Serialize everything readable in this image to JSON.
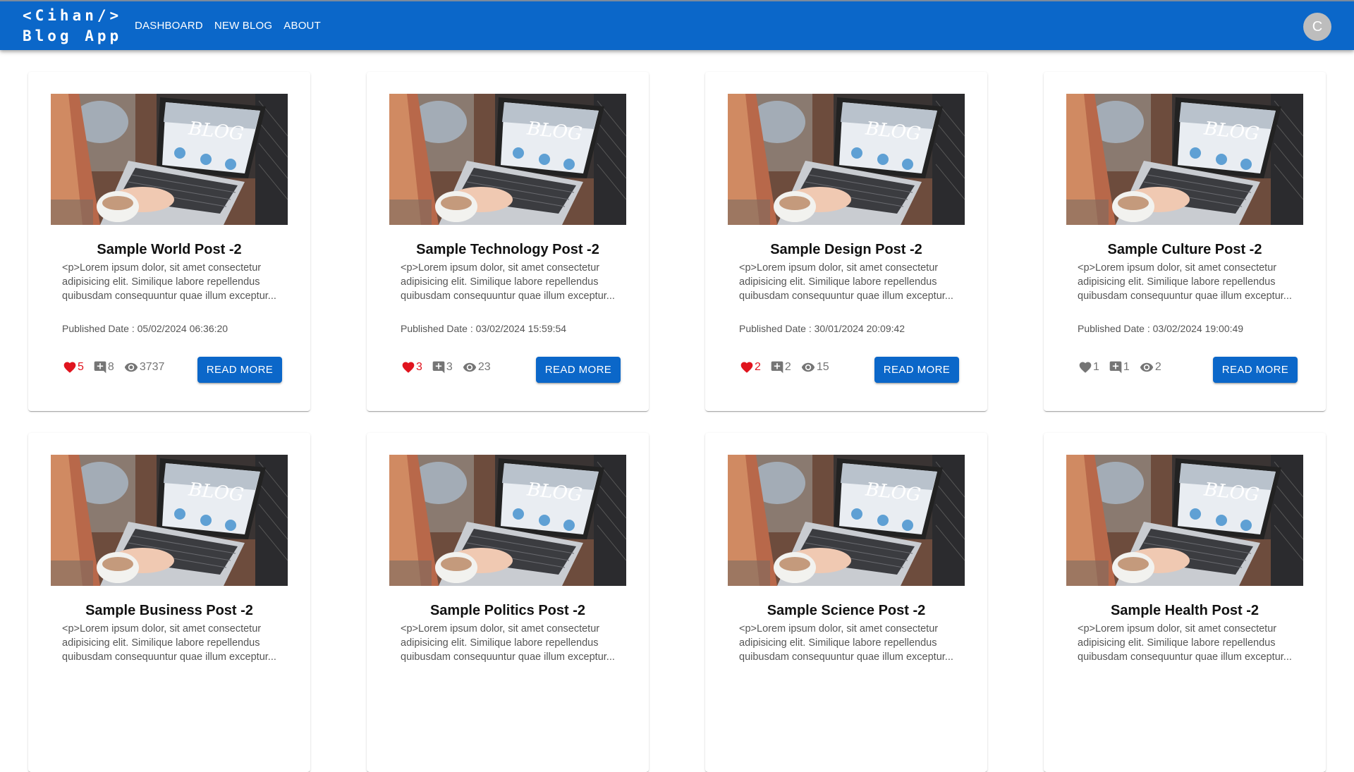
{
  "app": {
    "logo_line1": "<Cihan/>",
    "logo_line2": "Blog App",
    "nav": [
      "DASHBOARD",
      "NEW BLOG",
      "ABOUT"
    ],
    "avatar_initial": "C"
  },
  "colors": {
    "primary": "#0b67c9",
    "like_active": "#e0141e",
    "icon_gray": "#757575"
  },
  "icons": {
    "like": "heart-icon",
    "comments": "add-comment-icon",
    "views": "eye-icon"
  },
  "read_more_label": "READ MORE",
  "published_prefix": "Published Date : ",
  "posts": [
    {
      "title": "Sample World Post -2",
      "excerpt": "<p>Lorem ipsum dolor, sit amet consectetur adipisicing elit. Similique labore repellendus quibusdam consequuntur quae illum exceptur...",
      "date": "05/02/2024 06:36:20",
      "likes": "5",
      "comments": "8",
      "views": "3737",
      "liked": true
    },
    {
      "title": "Sample Technology Post -2",
      "excerpt": "<p>Lorem ipsum dolor, sit amet consectetur adipisicing elit. Similique labore repellendus quibusdam consequuntur quae illum exceptur...",
      "date": "03/02/2024 15:59:54",
      "likes": "3",
      "comments": "3",
      "views": "23",
      "liked": true
    },
    {
      "title": "Sample Design Post -2",
      "excerpt": "<p>Lorem ipsum dolor, sit amet consectetur adipisicing elit. Similique labore repellendus quibusdam consequuntur quae illum exceptur...",
      "date": "30/01/2024 20:09:42",
      "likes": "2",
      "comments": "2",
      "views": "15",
      "liked": true
    },
    {
      "title": "Sample Culture Post -2",
      "excerpt": "<p>Lorem ipsum dolor, sit amet consectetur adipisicing elit. Similique labore repellendus quibusdam consequuntur quae illum exceptur...",
      "date": "03/02/2024 19:00:49",
      "likes": "1",
      "comments": "1",
      "views": "2",
      "liked": false
    },
    {
      "title": "Sample Business Post -2",
      "excerpt": "<p>Lorem ipsum dolor, sit amet consectetur adipisicing elit. Similique labore repellendus quibusdam consequuntur quae illum exceptur...",
      "date": "",
      "likes": "",
      "comments": "",
      "views": "",
      "liked": false
    },
    {
      "title": "Sample Politics Post -2",
      "excerpt": "<p>Lorem ipsum dolor, sit amet consectetur adipisicing elit. Similique labore repellendus quibusdam consequuntur quae illum exceptur...",
      "date": "",
      "likes": "",
      "comments": "",
      "views": "",
      "liked": false
    },
    {
      "title": "Sample Science Post -2",
      "excerpt": "<p>Lorem ipsum dolor, sit amet consectetur adipisicing elit. Similique labore repellendus quibusdam consequuntur quae illum exceptur...",
      "date": "",
      "likes": "",
      "comments": "",
      "views": "",
      "liked": false
    },
    {
      "title": "Sample Health Post -2",
      "excerpt": "<p>Lorem ipsum dolor, sit amet consectetur adipisicing elit. Similique labore repellendus quibusdam consequuntur quae illum exceptur...",
      "date": "",
      "likes": "",
      "comments": "",
      "views": "",
      "liked": false
    }
  ]
}
